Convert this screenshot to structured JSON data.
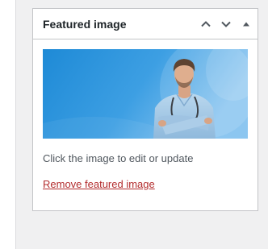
{
  "panel": {
    "title": "Featured image",
    "hint": "Click the image to edit or update",
    "remove_label": "Remove featured image"
  },
  "controls": {
    "move_up_icon": "chevron-up-icon",
    "move_down_icon": "chevron-down-icon",
    "toggle_icon": "triangle-up-icon"
  },
  "featured_image": {
    "subject": "doctor-with-stethoscope-photo"
  },
  "colors": {
    "link": "#b32d2e",
    "icon": "#50575e",
    "title": "#1d2327",
    "image_blue": "#2f8fd8"
  }
}
